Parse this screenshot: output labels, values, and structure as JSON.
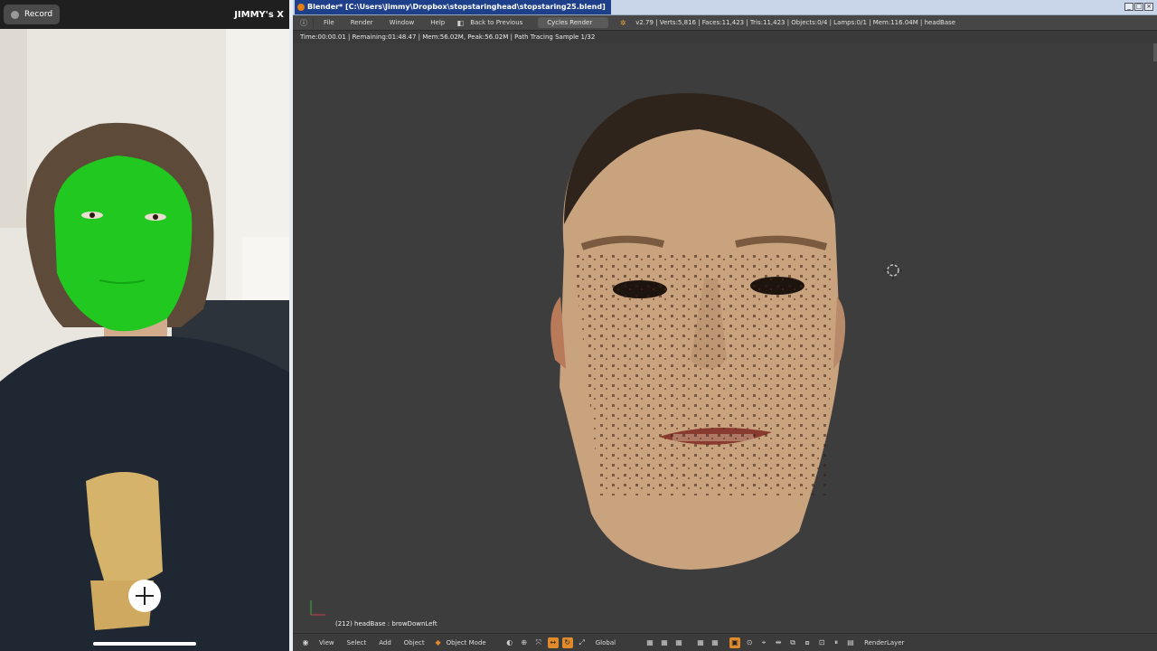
{
  "phone": {
    "record_label": "Record",
    "app_title": "JIMMY's X",
    "colors": {
      "face_mask": "#20c820",
      "shirt": "#1f2733",
      "shirt_print": "#d6b36a"
    }
  },
  "blender": {
    "window_title": "Blender* [C:\\Users\\Jimmy\\Dropbox\\stopstaringhead\\stopstaring25.blend]",
    "menu": [
      "File",
      "Render",
      "Window",
      "Help"
    ],
    "back_label": "Back to Previous",
    "render_engine": "Cycles Render",
    "stats": "v2.79 | Verts:5,816 | Faces:11,423 | Tris:11,423 | Objects:0/4 | Lamps:0/1 | Mem:116.04M | headBase",
    "render_info": "Time:00:00.01 | Remaining:01:48.47 | Mem:56.02M, Peak:56.02M | Path Tracing Sample 1/32",
    "viewport_status": "(212) headBase : browDownLeft",
    "footer": {
      "view": "View",
      "select": "Select",
      "add": "Add",
      "object": "Object",
      "mode": "Object Mode",
      "orientation": "Global",
      "layer": "RenderLayer"
    }
  }
}
